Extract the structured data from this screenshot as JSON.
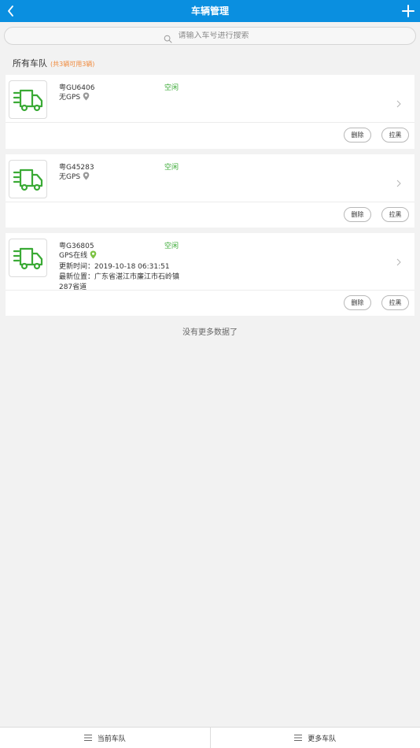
{
  "header": {
    "title": "车辆管理",
    "back_icon": "back-chevron-icon",
    "add_icon": "plus-icon"
  },
  "search": {
    "placeholder": "请输入车号进行搜索",
    "value": ""
  },
  "fleet": {
    "title": "所有车队",
    "summary": "(共3辆可用3辆)"
  },
  "vehicles": [
    {
      "plate": "粤GU6406",
      "status": "空闲",
      "gps": "无GPS",
      "gps_online": false,
      "delete_label": "删除",
      "block_label": "拉黑"
    },
    {
      "plate": "粤G45283",
      "status": "空闲",
      "gps": "无GPS",
      "gps_online": false,
      "delete_label": "删除",
      "block_label": "拉黑"
    },
    {
      "plate": "粤G36805",
      "status": "空闲",
      "gps": "GPS在线",
      "gps_online": true,
      "update_time": "更新时间：2019-10-18 06:31:51",
      "location_line1": "最新位置：广东省湛江市廉江市石岭镇",
      "location_line2": "287省道",
      "delete_label": "删除",
      "block_label": "拉黑"
    }
  ],
  "list_end": "没有更多数据了",
  "tabs": [
    {
      "label": "当前车队",
      "icon": "menu-icon"
    },
    {
      "label": "更多车队",
      "icon": "menu-icon"
    }
  ],
  "colors": {
    "brand": "#0a8fe0",
    "status_idle": "#3aaa35",
    "summary": "#f08a3c",
    "gps_online": "#7cc243",
    "gps_offline": "#9a9a9a",
    "truck": "#3aaa35"
  }
}
